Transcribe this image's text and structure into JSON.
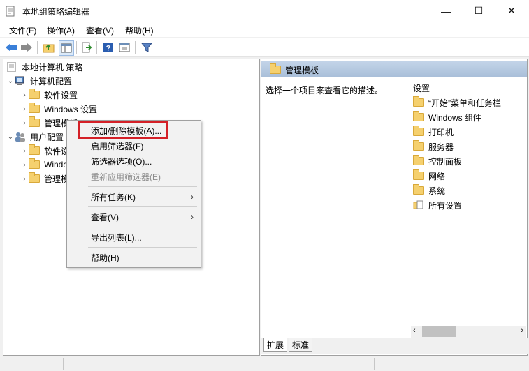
{
  "window": {
    "title": "本地组策略编辑器",
    "controls": {
      "minimize": "—",
      "maximize": "☐",
      "close": "✕"
    }
  },
  "menubar": {
    "items": [
      "文件(F)",
      "操作(A)",
      "查看(V)",
      "帮助(H)"
    ]
  },
  "toolbar": {
    "icons": [
      "back-arrow-icon",
      "forward-arrow-icon",
      "up-folder-icon",
      "show-hide-tree-icon",
      "export-list-icon",
      "help-icon",
      "properties-icon",
      "filter-icon"
    ]
  },
  "tree": {
    "root": "本地计算机 策略",
    "computer_config": "计算机配置",
    "computer_children": [
      "软件设置",
      "Windows 设置",
      "管理模板"
    ],
    "user_config": "用户配置",
    "user_children": [
      "软件设",
      "Windo",
      "管理模"
    ]
  },
  "right_pane": {
    "header_title": "管理模板",
    "description": "选择一个项目来查看它的描述。",
    "list_header": "设置",
    "items": [
      "“开始”菜单和任务栏",
      "Windows 组件",
      "打印机",
      "服务器",
      "控制面板",
      "网络",
      "系统",
      "所有设置"
    ],
    "tabs": [
      "扩展",
      "标准"
    ]
  },
  "context_menu": {
    "items": [
      {
        "label": "添加/删除模板(A)...",
        "enabled": true,
        "submenu": false
      },
      {
        "label": "启用筛选器(F)",
        "enabled": true,
        "submenu": false
      },
      {
        "label": "筛选器选项(O)...",
        "enabled": true,
        "submenu": false
      },
      {
        "label": "重新应用筛选器(E)",
        "enabled": false,
        "submenu": false
      },
      {
        "label": "所有任务(K)",
        "enabled": true,
        "submenu": true
      },
      {
        "label": "查看(V)",
        "enabled": true,
        "submenu": true
      },
      {
        "label": "导出列表(L)...",
        "enabled": true,
        "submenu": false
      },
      {
        "label": "帮助(H)",
        "enabled": true,
        "submenu": false
      }
    ],
    "submenu_arrow": "›",
    "highlight_color": "#d42027"
  },
  "colors": {
    "pane_header": "#b4c8df",
    "folder": "#f5d06e",
    "accent_blue": "#2c6fcf"
  }
}
